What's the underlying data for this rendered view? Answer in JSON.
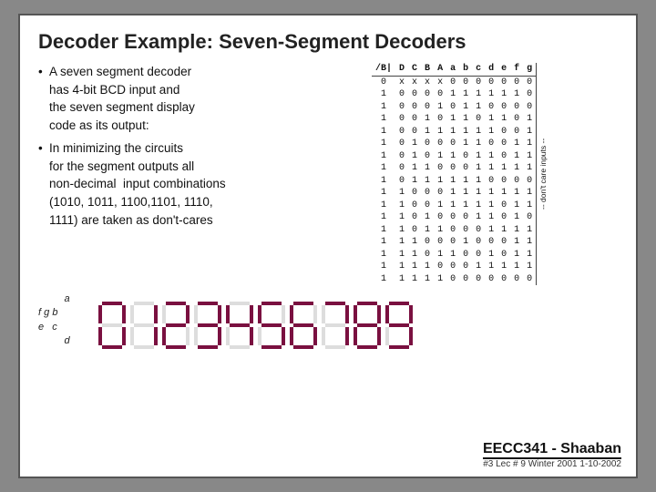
{
  "slide": {
    "title": "Decoder Example: Seven-Segment Decoders",
    "bullets": [
      {
        "main": "A seven segment decoder has 4-bit BCD input and the seven segment display code as its output:",
        "lines": [
          "A seven segment decoder",
          "has 4-bit BCD input and",
          "the seven segment display",
          "code as its output:"
        ]
      },
      {
        "main": "In minimizing the circuits for the segment outputs all non-decimal input combinations (1010, 1011, 1100,1101, 1110, 1111) are taken as don't-cares",
        "lines": [
          "In minimizing the circuits",
          "for the segment outputs all",
          "non-decimal  input combinations",
          "(1010, 1011, 1100,1101, 1110,",
          "1111) are taken as don't-cares"
        ]
      }
    ],
    "table": {
      "headers": [
        "/B|",
        "D",
        "C",
        "B",
        "A",
        "a",
        "b",
        "c",
        "d",
        "e",
        "f",
        "g"
      ],
      "rows": [
        [
          "0",
          "x",
          "x",
          "x",
          "x",
          "0",
          "0",
          "0",
          "0",
          "0",
          "0",
          "0"
        ],
        [
          "1",
          "0",
          "0",
          "0",
          "0",
          "1",
          "1",
          "1",
          "1",
          "1",
          "1",
          "0"
        ],
        [
          "1",
          "0",
          "0",
          "0",
          "1",
          "0",
          "1",
          "1",
          "0",
          "0",
          "0",
          "0"
        ],
        [
          "1",
          "0",
          "0",
          "1",
          "0",
          "1",
          "1",
          "0",
          "1",
          "1",
          "0",
          "1"
        ],
        [
          "1",
          "0",
          "0",
          "1",
          "1",
          "1",
          "1",
          "1",
          "1",
          "0",
          "0",
          "1"
        ],
        [
          "1",
          "0",
          "1",
          "0",
          "0",
          "0",
          "1",
          "1",
          "0",
          "0",
          "1",
          "1"
        ],
        [
          "1",
          "0",
          "1",
          "0",
          "1",
          "1",
          "0",
          "1",
          "1",
          "0",
          "1",
          "1"
        ],
        [
          "1",
          "0",
          "1",
          "1",
          "0",
          "0",
          "0",
          "1",
          "1",
          "1",
          "1",
          "1"
        ],
        [
          "1",
          "0",
          "1",
          "1",
          "1",
          "1",
          "1",
          "1",
          "0",
          "0",
          "0",
          "0"
        ],
        [
          "1",
          "1",
          "0",
          "0",
          "0",
          "1",
          "1",
          "1",
          "1",
          "1",
          "1",
          "1"
        ],
        [
          "1",
          "1",
          "0",
          "0",
          "1",
          "1",
          "1",
          "1",
          "1",
          "0",
          "1",
          "1"
        ],
        [
          "1",
          "1",
          "0",
          "1",
          "0",
          "0",
          "0",
          "1",
          "1",
          "0",
          "1",
          "0"
        ],
        [
          "1",
          "1",
          "0",
          "1",
          "1",
          "0",
          "0",
          "0",
          "1",
          "1",
          "1",
          "1"
        ],
        [
          "1",
          "1",
          "1",
          "0",
          "0",
          "0",
          "1",
          "0",
          "0",
          "0",
          "1",
          "1"
        ],
        [
          "1",
          "1",
          "1",
          "0",
          "1",
          "1",
          "0",
          "0",
          "1",
          "0",
          "1",
          "1"
        ],
        [
          "1",
          "1",
          "1",
          "1",
          "0",
          "0",
          "0",
          "1",
          "1",
          "1",
          "1",
          "1"
        ],
        [
          "1",
          "1",
          "1",
          "1",
          "1",
          "0",
          "0",
          "0",
          "0",
          "0",
          "0",
          "0"
        ]
      ],
      "dontcare_label": "-- don't care inputs --"
    },
    "seg_diagram_label": "a\nf g b\ne   c\nd",
    "footer": {
      "title": "EECC341 - Shaaban",
      "subtitle": "#3  Lec # 9  Winter 2001  1-10-2002"
    },
    "digits": [
      {
        "label": "0",
        "segs": [
          1,
          1,
          1,
          1,
          1,
          1,
          0
        ]
      },
      {
        "label": "1",
        "segs": [
          0,
          1,
          1,
          0,
          0,
          0,
          0
        ]
      },
      {
        "label": "2",
        "segs": [
          1,
          1,
          0,
          1,
          1,
          0,
          1
        ]
      },
      {
        "label": "3",
        "segs": [
          1,
          1,
          1,
          1,
          0,
          0,
          1
        ]
      },
      {
        "label": "4",
        "segs": [
          0,
          1,
          1,
          0,
          0,
          1,
          1
        ]
      },
      {
        "label": "5",
        "segs": [
          1,
          0,
          1,
          1,
          0,
          1,
          1
        ]
      },
      {
        "label": "6",
        "segs": [
          1,
          0,
          1,
          1,
          1,
          1,
          1
        ]
      },
      {
        "label": "7",
        "segs": [
          1,
          1,
          1,
          0,
          0,
          0,
          0
        ]
      },
      {
        "label": "8",
        "segs": [
          1,
          1,
          1,
          1,
          1,
          1,
          1
        ]
      },
      {
        "label": "9",
        "segs": [
          1,
          1,
          1,
          1,
          0,
          1,
          1
        ]
      }
    ]
  }
}
